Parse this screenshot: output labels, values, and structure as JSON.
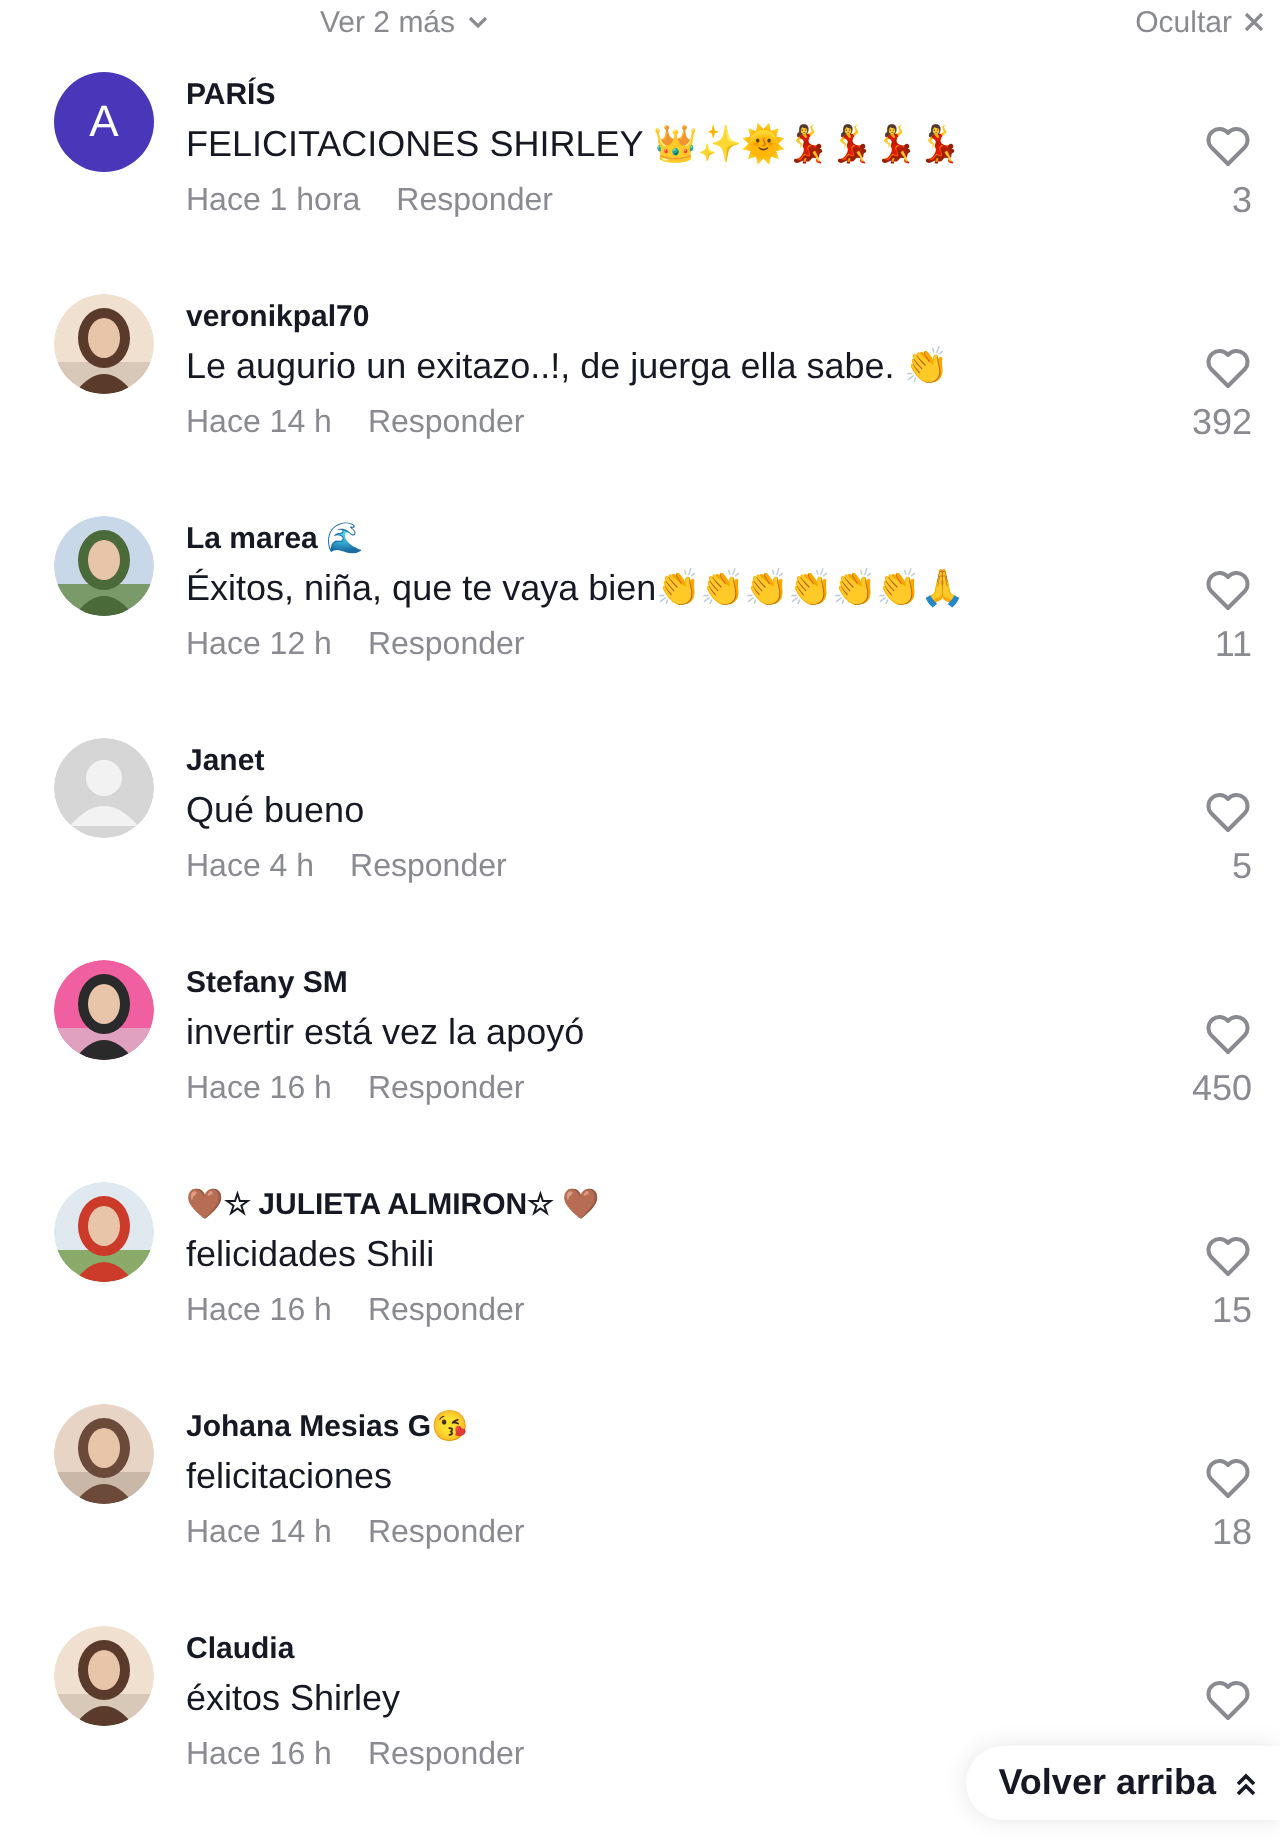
{
  "top_bar": {
    "more_label": "Ver 2 más",
    "hide_label": "Ocultar"
  },
  "comments": [
    {
      "author": "PARÍS",
      "avatar": {
        "kind": "letter",
        "letter": "A"
      },
      "text": "FELICITACIONES SHIRLEY 👑✨🌞💃💃💃💃",
      "time": "Hace 1 hora",
      "reply": "Responder",
      "likes": "3"
    },
    {
      "author": "veronikpal70",
      "text": "Le augurio un exitazo..!, de juerga ella sabe. 👏",
      "time": "Hace 14 h",
      "reply": "Responder",
      "likes": "392"
    },
    {
      "author": "La marea 🌊",
      "text": "Éxitos, niña, que te vaya bien👏👏👏👏👏👏🙏",
      "time": "Hace 12 h",
      "reply": "Responder",
      "likes": "11"
    },
    {
      "author": "Janet",
      "avatar": {
        "kind": "default"
      },
      "text": "Qué bueno",
      "time": "Hace 4 h",
      "reply": "Responder",
      "likes": "5"
    },
    {
      "author": "Stefany SM",
      "text": "invertir está vez la apoyó",
      "time": "Hace 16 h",
      "reply": "Responder",
      "likes": "450"
    },
    {
      "author": "🤎☆ JULIETA ALMIRON☆ 🤎",
      "text": "felicidades Shili",
      "time": "Hace 16 h",
      "reply": "Responder",
      "likes": "15"
    },
    {
      "author": "Johana Mesias G😘",
      "text": "felicitaciones",
      "time": "Hace 14 h",
      "reply": "Responder",
      "likes": "18"
    },
    {
      "author": "Claudia",
      "text": "éxitos Shirley",
      "time": "Hace 16 h",
      "reply": "Responder"
    }
  ],
  "back_to_top": {
    "label": "Volver arriba"
  }
}
